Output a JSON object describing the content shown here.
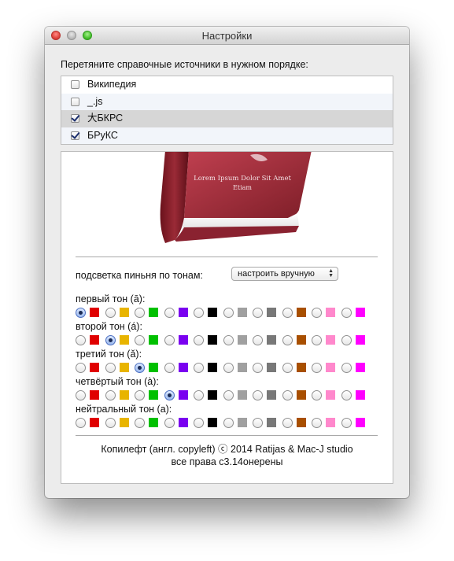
{
  "window": {
    "title": "Настройки"
  },
  "instruction": "Перетяните справочные источники в нужном порядке:",
  "sources": [
    {
      "label": "Википедия",
      "checked": false
    },
    {
      "label": "_.js",
      "checked": false
    },
    {
      "label": "大БКРС",
      "checked": true
    },
    {
      "label": "БРуКС",
      "checked": true
    }
  ],
  "book": {
    "line1": "Lorem Ipsum Dolor Sit Amet",
    "line2": "Etiam"
  },
  "highlight": {
    "label": "подсветка пиньня по тонам:",
    "select_value": "настроить вручную"
  },
  "palette": [
    "#e00000",
    "#e8b400",
    "#00c000",
    "#7a00f0",
    "#000000",
    "#a0a0a0",
    "#787878",
    "#a84f00",
    "#ff88cc",
    "#ff00ff"
  ],
  "tones": [
    {
      "label": "первый тон (ā):",
      "selected": 0
    },
    {
      "label": "второй тон (á):",
      "selected": 2
    },
    {
      "label": "третий тон (ǎ):",
      "selected": 4
    },
    {
      "label": "четвёртый тон (à):",
      "selected": 6
    },
    {
      "label": "нейтральный тон (a):",
      "selected": 11
    }
  ],
  "footer": {
    "line1": "Копилефт (англ. copyleft) ⓒ 2014 Ratijas & Mac-J studio",
    "line2": "все права с3.14онерены"
  }
}
